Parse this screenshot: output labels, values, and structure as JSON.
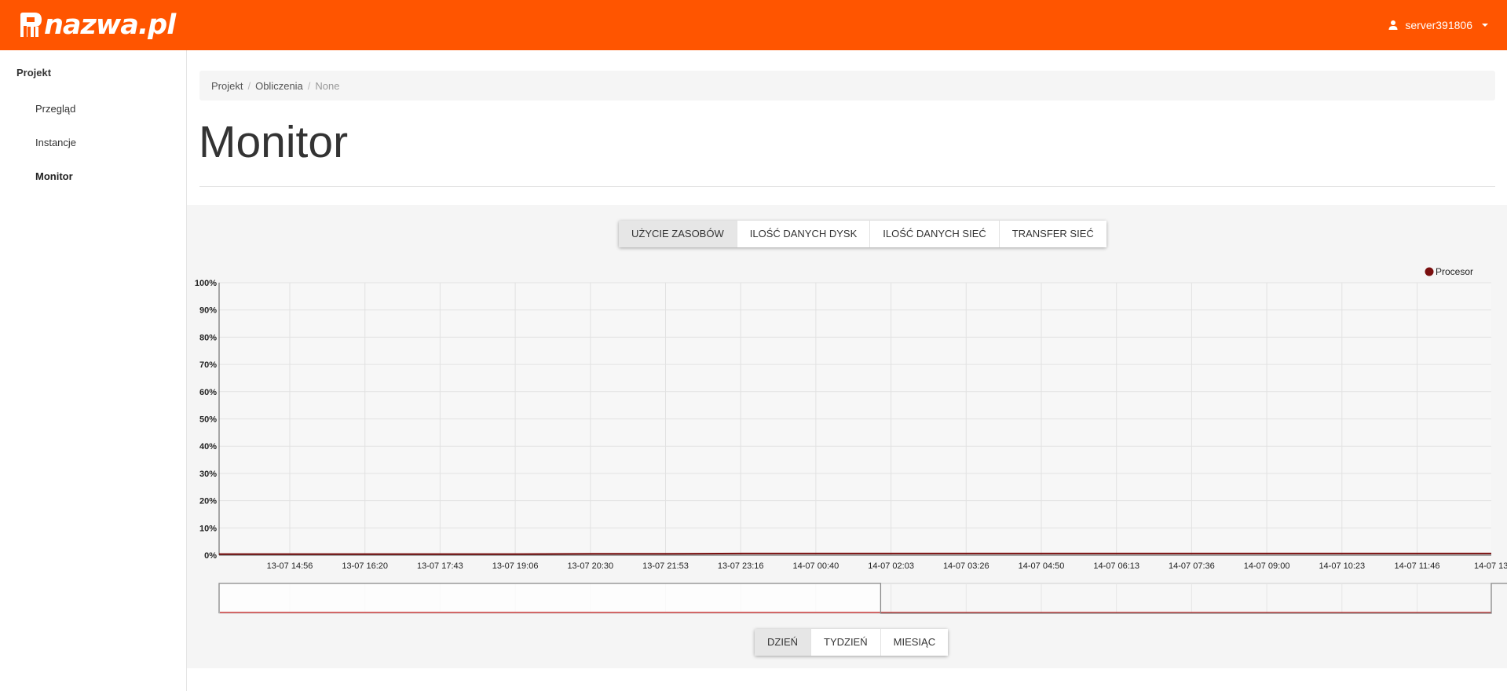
{
  "app": {
    "brand": "nazwa.pl",
    "user": "server391806",
    "brand_color": "#ff5500"
  },
  "sidebar": {
    "section": "Projekt",
    "items": [
      {
        "label": "Przegląd"
      },
      {
        "label": "Instancje"
      },
      {
        "label": "Monitor",
        "active": true
      }
    ]
  },
  "breadcrumb": [
    "Projekt",
    "Obliczenia",
    "None"
  ],
  "page": {
    "title": "Monitor"
  },
  "metric_tabs": [
    {
      "label": "UŻYCIE ZASOBÓW",
      "active": true
    },
    {
      "label": "ILOŚĆ DANYCH DYSK"
    },
    {
      "label": "ILOŚĆ DANYCH SIEĆ"
    },
    {
      "label": "TRANSFER SIEĆ"
    }
  ],
  "range_tabs": [
    {
      "label": "DZIEŃ",
      "active": true
    },
    {
      "label": "TYDZIEŃ"
    },
    {
      "label": "MIESIĄC"
    }
  ],
  "chart_data": {
    "type": "line",
    "legend_position": "top-right",
    "grid": true,
    "y_ticks": [
      "100%",
      "90%",
      "80%",
      "70%",
      "60%",
      "50%",
      "40%",
      "30%",
      "20%",
      "10%",
      "0%"
    ],
    "ylim": [
      0,
      100
    ],
    "x_ticks": [
      "13-07 14:56",
      "13-07 16:20",
      "13-07 17:43",
      "13-07 19:06",
      "13-07 20:30",
      "13-07 21:53",
      "13-07 23:16",
      "14-07 00:40",
      "14-07 02:03",
      "14-07 03:26",
      "14-07 04:50",
      "14-07 06:13",
      "14-07 07:36",
      "14-07 09:00",
      "14-07 10:23",
      "14-07 11:46",
      "14-07 13:"
    ],
    "series": [
      {
        "name": "Procesor",
        "color": "#7a0f0f",
        "values": [
          0.4,
          0.4,
          0.4,
          0.4,
          0.4,
          0.5,
          0.5,
          0.6,
          0.6,
          0.6,
          0.6,
          0.6,
          0.6,
          0.6,
          0.6,
          0.6,
          0.6,
          0.6
        ]
      }
    ],
    "navigator_selection": [
      0.52,
      1.0
    ]
  }
}
